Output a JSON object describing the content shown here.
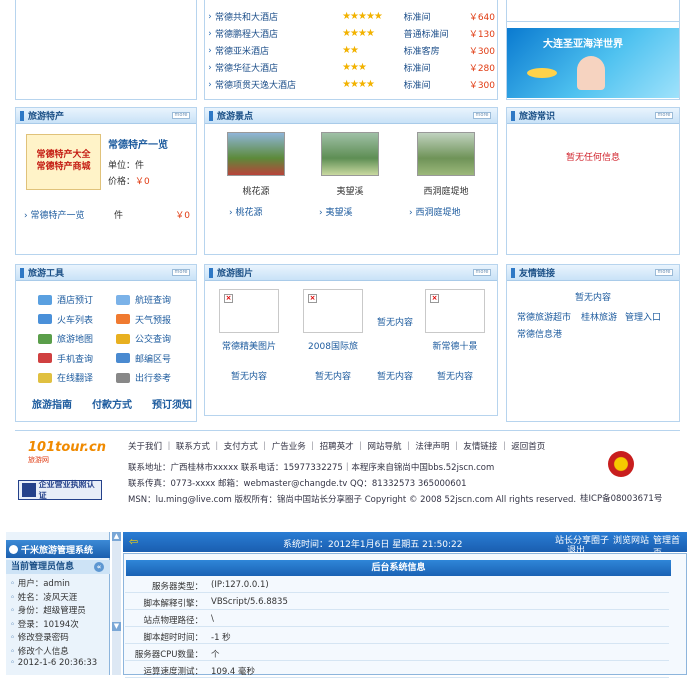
{
  "hotels": [
    {
      "name": "常德共和大酒店",
      "stars": "★★★★★",
      "type": "标准间",
      "price": "￥640"
    },
    {
      "name": "常德鹏程大酒店",
      "stars": "★★★★",
      "type": "普通标准间",
      "price": "￥130"
    },
    {
      "name": "常德亚米酒店",
      "stars": "★★",
      "type": "标准客房",
      "price": "￥300"
    },
    {
      "name": "常德华征大酒店",
      "stars": "★★★",
      "type": "标准间",
      "price": "￥280"
    },
    {
      "name": "常德项贯天逸大酒店",
      "stars": "★★★★",
      "type": "标准间",
      "price": "￥300"
    }
  ],
  "banner": {
    "text": "大连圣亚海洋世界"
  },
  "specialty": {
    "title": "旅游特产",
    "img_text": "常德特产大全\n常德特产商城",
    "name": "常德特产一览",
    "unit_label": "单位：件",
    "price_label": "价格：",
    "price": "￥0",
    "row_name": "常德特产一览",
    "row_unit": "件",
    "row_price": "￥0"
  },
  "scenic": {
    "title": "旅游景点",
    "items": [
      "桃花源",
      "夷望溪",
      "西洞庭堤地"
    ],
    "links": [
      "桃花源",
      "夷望溪",
      "西洞庭堤地"
    ]
  },
  "knowledge": {
    "title": "旅游常识",
    "empty": "暂无任何信息"
  },
  "tools": {
    "title": "旅游工具",
    "items": [
      "酒店预订",
      "航班查询",
      "火车列表",
      "天气预报",
      "旅游地图",
      "公交查询",
      "手机查询",
      "邮编区号",
      "在线翻译",
      "出行参考"
    ],
    "big": [
      "旅游指南",
      "付款方式",
      "预订须知"
    ]
  },
  "photos": {
    "title": "旅游图片",
    "captions": [
      "常德精美图片",
      "2008国际旅",
      "暂无内容",
      "新常德十景"
    ],
    "empty": [
      "暂无内容",
      "暂无内容",
      "暂无内容",
      "暂无内容"
    ]
  },
  "friends": {
    "title": "友情链接",
    "empty": "暂无内容",
    "links": [
      "常德旅游超市",
      "桂林旅游",
      "管理入口",
      "常德信息港"
    ]
  },
  "footer": {
    "logo": "101tour.cn",
    "logo_sub": "旅游网",
    "cert": "企业营业执照认证",
    "nav": "关于我们 ｜ 联系方式 ｜ 支付方式 ｜ 广告业务 ｜ 招聘英才 ｜ 网站导航 ｜ 法律声明 ｜ 友情链接 ｜ 返回首页",
    "line1": "联系地址：广西桂林市xxxxx  联系电话：15977332275｜本程序来自锦尚中国bbs.52jscn.com",
    "line2": "联系传真：0773-xxxx  邮箱：webmaster@changde.tv  QQ：81332573 365000601",
    "line3": "MSN：lu.ming@live.com   版权所有：锦尚中国站长分享圈子  Copyright © 2008 52jscn.com All rights reserved.",
    "icp": "桂ICP备08003671号"
  },
  "admin": {
    "sys_title": "千米旅游管理系统",
    "manager_info": "当前管理员信息",
    "info": [
      "用户：admin",
      "姓名：凌风天涯",
      "身份：超级管理员",
      "登录：10194次",
      "修改登录密码",
      "修改个人信息",
      "2012-1-6 20:36:33"
    ],
    "time_label": "系统时间：2012年1月6日 星期五 21:50:22",
    "top_links": [
      "站长分享圈子",
      "浏览网站",
      "管理首页",
      "退出"
    ],
    "section": "后台系统信息",
    "rows": [
      {
        "k": "服务器类型：",
        "v": "(IP:127.0.0.1)"
      },
      {
        "k": "脚本解释引擎：",
        "v": "VBScript/5.6.8835"
      },
      {
        "k": "站点物理路径：",
        "v": "\\"
      },
      {
        "k": "脚本超时时间：",
        "v": "-1 秒"
      },
      {
        "k": "服务器CPU数量：",
        "v": "个"
      },
      {
        "k": "运算速度测试：",
        "v": "109.4 毫秒"
      }
    ]
  },
  "colors": {
    "accent": "#1d5b9e",
    "price": "#e03b12",
    "star": "#f2b200",
    "head_bg": "#c9e2f7"
  }
}
